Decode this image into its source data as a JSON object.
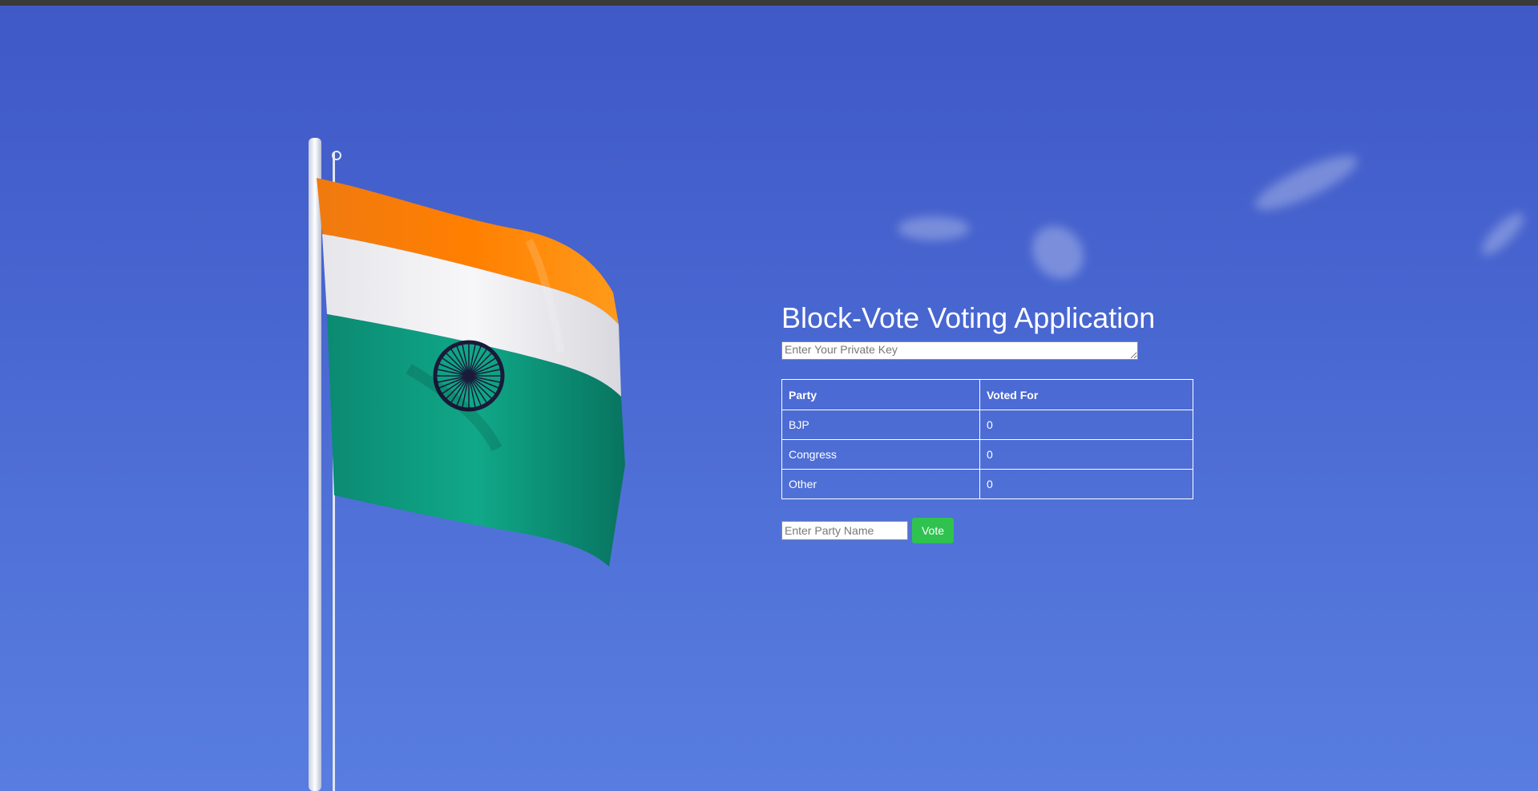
{
  "app": {
    "title": "Block-Vote Voting Application"
  },
  "private_key": {
    "placeholder": "Enter Your Private Key",
    "value": ""
  },
  "results_table": {
    "headers": [
      "Party",
      "Voted For"
    ],
    "rows": [
      {
        "party": "BJP",
        "votes": "0"
      },
      {
        "party": "Congress",
        "votes": "0"
      },
      {
        "party": "Other",
        "votes": "0"
      }
    ]
  },
  "vote_form": {
    "party_placeholder": "Enter Party Name",
    "party_value": "",
    "vote_label": "Vote"
  },
  "colors": {
    "sky": "#4764cf",
    "text": "#ffffff",
    "vote_button": "#2fc24f",
    "flag_saffron": "#ff7a00",
    "flag_white": "#f2f2f2",
    "flag_green": "#0f9a80",
    "chakra": "#1a1a3a"
  },
  "icons": {
    "background": "indian-flag-image"
  }
}
